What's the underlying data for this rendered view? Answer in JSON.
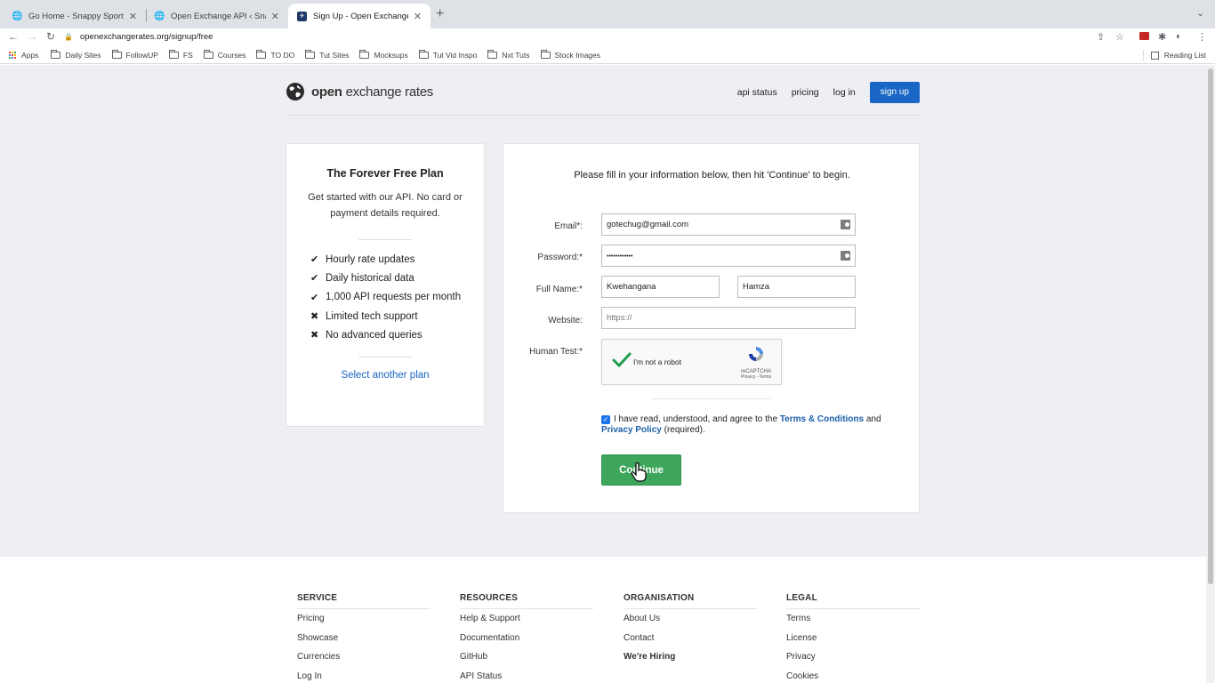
{
  "browser": {
    "tabs": [
      {
        "title": "Go Home - Snappy Sports",
        "icon": "globe-icon",
        "active": false
      },
      {
        "title": "Open Exchange API ‹ Snappy S",
        "icon": "globe-icon",
        "active": false
      },
      {
        "title": "Sign Up - Open Exchange Rate",
        "icon": "oxr-favicon",
        "active": true
      }
    ],
    "url": "openexchangerates.org/signup/free",
    "bookmarks": [
      {
        "label": "Apps",
        "icon": "apps-grid-icon"
      },
      {
        "label": "Daily Sites",
        "icon": "folder-icon"
      },
      {
        "label": "FollowUP",
        "icon": "folder-icon"
      },
      {
        "label": "FS",
        "icon": "folder-icon"
      },
      {
        "label": "Courses",
        "icon": "folder-icon"
      },
      {
        "label": "TO DO",
        "icon": "folder-icon"
      },
      {
        "label": "Tut Sites",
        "icon": "folder-icon"
      },
      {
        "label": "Mocksups",
        "icon": "folder-icon"
      },
      {
        "label": "Tut Vid Inspo",
        "icon": "folder-icon"
      },
      {
        "label": "Nxt Tuts",
        "icon": "folder-icon"
      },
      {
        "label": "Stock Images",
        "icon": "folder-icon"
      }
    ],
    "reading_list": "Reading List"
  },
  "site": {
    "logo_bold": "open",
    "logo_rest": "exchange rates",
    "nav": [
      "api status",
      "pricing",
      "log in"
    ],
    "signup": "sign up",
    "accent": "#1a66c4"
  },
  "plan": {
    "title": "The Forever Free Plan",
    "description": "Get started with our API. No card or payment details required.",
    "features": [
      {
        "text": "Hourly rate updates",
        "included": true
      },
      {
        "text": "Daily historical data",
        "included": true
      },
      {
        "text": "1,000 API requests per month",
        "included": true
      },
      {
        "text": "Limited tech support",
        "included": false
      },
      {
        "text": "No advanced queries",
        "included": false
      }
    ],
    "link": "Select another plan"
  },
  "form": {
    "intro": "Please fill in your information below, then hit 'Continue' to begin.",
    "email_label": "Email*:",
    "email_value": "gotechug@gmail.com",
    "password_label": "Password:*",
    "password_value": "••••••••••••",
    "fullname_label": "Full Name:*",
    "first_name": "Kwehangana",
    "last_name": "Hamza",
    "website_label": "Website:",
    "website_placeholder": "https://",
    "human_label": "Human Test:*",
    "captcha_text": "I'm not a robot",
    "captcha_brand": "reCAPTCHA",
    "captcha_links": "Privacy - Terms",
    "terms_pre": "I have read, understood, and agree to the",
    "terms_link": "Terms & Conditions",
    "terms_and": "and",
    "privacy_link": "Privacy Policy",
    "terms_post": "(required).",
    "terms_checked": true,
    "continue": "Continue",
    "button_color": "#3ea65a"
  },
  "footer": {
    "columns": [
      {
        "heading": "SERVICE",
        "links": [
          "Pricing",
          "Showcase",
          "Currencies",
          "Log In"
        ]
      },
      {
        "heading": "RESOURCES",
        "links": [
          "Help & Support",
          "Documentation",
          "GitHub",
          "API Status"
        ]
      },
      {
        "heading": "ORGANISATION",
        "links": [
          "About Us",
          "Contact",
          "We're Hiring"
        ]
      },
      {
        "heading": "LEGAL",
        "links": [
          "Terms",
          "License",
          "Privacy",
          "Cookies"
        ]
      }
    ]
  }
}
